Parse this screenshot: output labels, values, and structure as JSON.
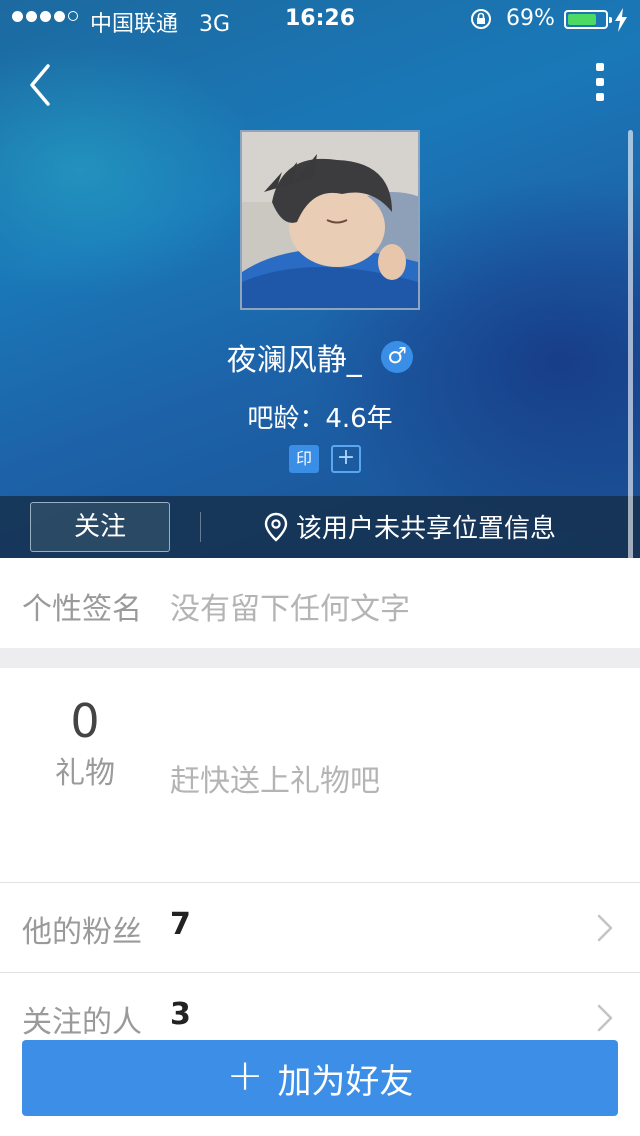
{
  "status_bar": {
    "carrier": "中国联通",
    "network": "3G",
    "time": "16:26",
    "battery_percent": "69%",
    "battery_level": 0.69,
    "signal_bars_filled": 4,
    "signal_bars_total": 5
  },
  "nav": {
    "back_icon": "chevron-left-icon",
    "more_icon": "vertical-dots-icon"
  },
  "profile": {
    "username": "夜澜风静_",
    "gender_symbol": "♂",
    "age_label": "吧龄：4.6年",
    "badge_seal_text": "印",
    "badge_add_text": "+"
  },
  "actions": {
    "follow_label": "关注",
    "location_text": "该用户未共享位置信息"
  },
  "signature": {
    "label": "个性签名",
    "value": "没有留下任何文字"
  },
  "gifts": {
    "count": "0",
    "label": "礼物",
    "prompt": "赶快送上礼物吧"
  },
  "stats": {
    "fans_label": "他的粉丝",
    "fans_count": "7",
    "following_label": "关注的人",
    "following_count": "3"
  },
  "bottom_button": {
    "plus": "+",
    "label": "加为好友"
  },
  "colors": {
    "accent": "#3d8ee7",
    "header_blue": "#1a78b8",
    "battery_green": "#4cd964"
  }
}
